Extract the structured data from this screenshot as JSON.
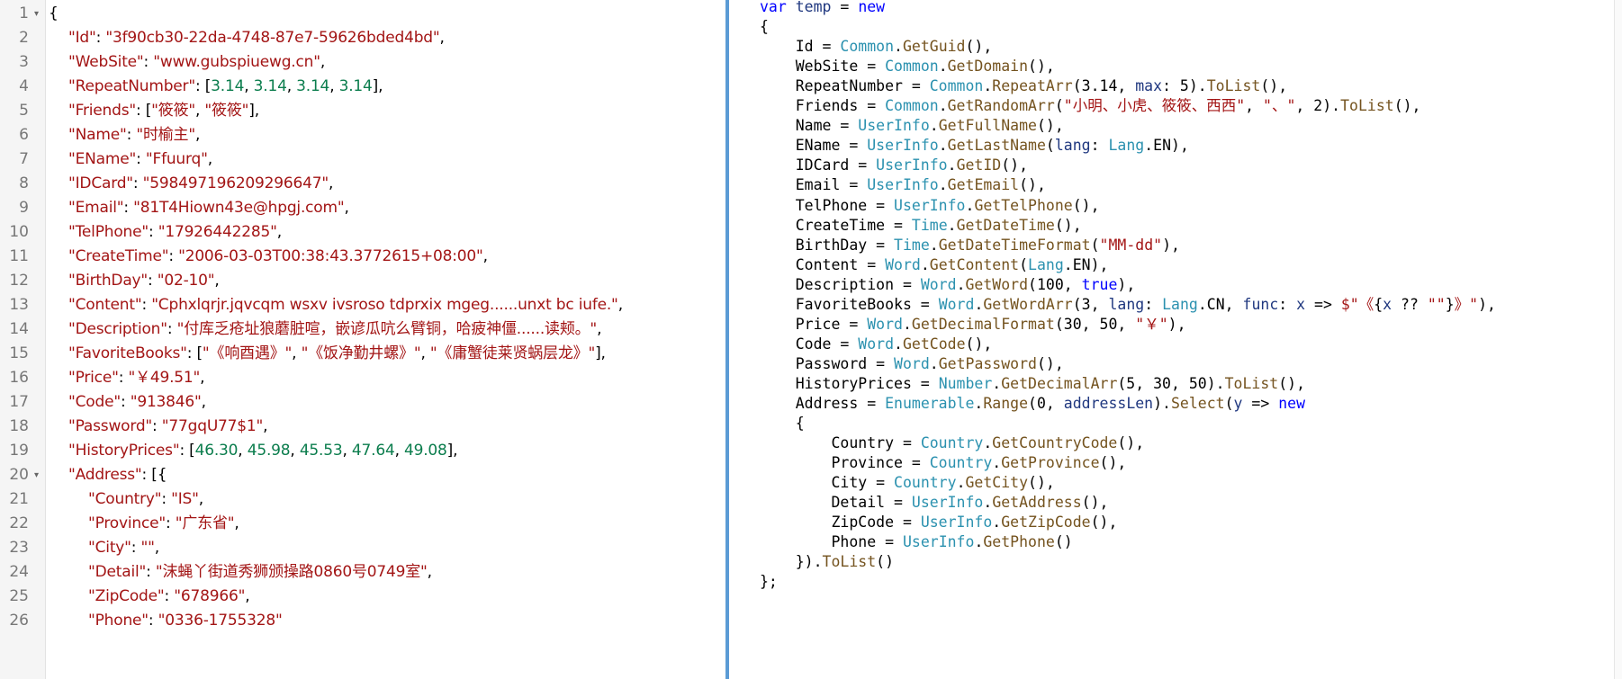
{
  "json_lines": [
    [
      [
        "p",
        "{"
      ]
    ],
    [
      [
        "k",
        "\"Id\""
      ],
      [
        "p",
        ": "
      ],
      [
        "s",
        "\"3f90cb30-22da-4748-87e7-59626bded4bd\""
      ],
      [
        "p",
        ","
      ]
    ],
    [
      [
        "k",
        "\"WebSite\""
      ],
      [
        "p",
        ": "
      ],
      [
        "s",
        "\"www.gubspiuewg.cn\""
      ],
      [
        "p",
        ","
      ]
    ],
    [
      [
        "k",
        "\"RepeatNumber\""
      ],
      [
        "p",
        ": ["
      ],
      [
        "n",
        "3.14"
      ],
      [
        "p",
        ", "
      ],
      [
        "n",
        "3.14"
      ],
      [
        "p",
        ", "
      ],
      [
        "n",
        "3.14"
      ],
      [
        "p",
        ", "
      ],
      [
        "n",
        "3.14"
      ],
      [
        "p",
        "],"
      ]
    ],
    [
      [
        "k",
        "\"Friends\""
      ],
      [
        "p",
        ": ["
      ],
      [
        "s",
        "\"筱筱\""
      ],
      [
        "p",
        ", "
      ],
      [
        "s",
        "\"筱筱\""
      ],
      [
        "p",
        "],"
      ]
    ],
    [
      [
        "k",
        "\"Name\""
      ],
      [
        "p",
        ": "
      ],
      [
        "s",
        "\"时榆主\""
      ],
      [
        "p",
        ","
      ]
    ],
    [
      [
        "k",
        "\"EName\""
      ],
      [
        "p",
        ": "
      ],
      [
        "s",
        "\"Ffuurq\""
      ],
      [
        "p",
        ","
      ]
    ],
    [
      [
        "k",
        "\"IDCard\""
      ],
      [
        "p",
        ": "
      ],
      [
        "s",
        "\"598497196209296647\""
      ],
      [
        "p",
        ","
      ]
    ],
    [
      [
        "k",
        "\"Email\""
      ],
      [
        "p",
        ": "
      ],
      [
        "s",
        "\"81T4Hiown43e@hpgj.com\""
      ],
      [
        "p",
        ","
      ]
    ],
    [
      [
        "k",
        "\"TelPhone\""
      ],
      [
        "p",
        ": "
      ],
      [
        "s",
        "\"17926442285\""
      ],
      [
        "p",
        ","
      ]
    ],
    [
      [
        "k",
        "\"CreateTime\""
      ],
      [
        "p",
        ": "
      ],
      [
        "s",
        "\"2006-03-03T00:38:43.3772615+08:00\""
      ],
      [
        "p",
        ","
      ]
    ],
    [
      [
        "k",
        "\"BirthDay\""
      ],
      [
        "p",
        ": "
      ],
      [
        "s",
        "\"02-10\""
      ],
      [
        "p",
        ","
      ]
    ],
    [
      [
        "k",
        "\"Content\""
      ],
      [
        "p",
        ": "
      ],
      [
        "s",
        "\"Cphxlqrjr.jqvcqm wsxv ivsroso tdprxix mgeg......unxt bc iufe.\""
      ],
      [
        "p",
        ","
      ]
    ],
    [
      [
        "k",
        "\"Description\""
      ],
      [
        "p",
        ": "
      ],
      [
        "s",
        "\"付库乏疮址狼蘑脏喧，嵌谚瓜吭么臂铜，哈疲神僵......读颊。\""
      ],
      [
        "p",
        ","
      ]
    ],
    [
      [
        "k",
        "\"FavoriteBooks\""
      ],
      [
        "p",
        ": ["
      ],
      [
        "s",
        "\"《响酉遇》\""
      ],
      [
        "p",
        ", "
      ],
      [
        "s",
        "\"《饭净勤井螺》\""
      ],
      [
        "p",
        ", "
      ],
      [
        "s",
        "\"《庸蟹徒莱贤蜗层龙》\""
      ],
      [
        "p",
        "],"
      ]
    ],
    [
      [
        "k",
        "\"Price\""
      ],
      [
        "p",
        ": "
      ],
      [
        "s",
        "\"￥49.51\""
      ],
      [
        "p",
        ","
      ]
    ],
    [
      [
        "k",
        "\"Code\""
      ],
      [
        "p",
        ": "
      ],
      [
        "s",
        "\"913846\""
      ],
      [
        "p",
        ","
      ]
    ],
    [
      [
        "k",
        "\"Password\""
      ],
      [
        "p",
        ": "
      ],
      [
        "s",
        "\"77gqU77$1\""
      ],
      [
        "p",
        ","
      ]
    ],
    [
      [
        "k",
        "\"HistoryPrices\""
      ],
      [
        "p",
        ": ["
      ],
      [
        "n",
        "46.30"
      ],
      [
        "p",
        ", "
      ],
      [
        "n",
        "45.98"
      ],
      [
        "p",
        ", "
      ],
      [
        "n",
        "45.53"
      ],
      [
        "p",
        ", "
      ],
      [
        "n",
        "47.64"
      ],
      [
        "p",
        ", "
      ],
      [
        "n",
        "49.08"
      ],
      [
        "p",
        "],"
      ]
    ],
    [
      [
        "k",
        "\"Address\""
      ],
      [
        "p",
        ": [{"
      ]
    ],
    [
      [
        "k",
        "\"Country\""
      ],
      [
        "p",
        ": "
      ],
      [
        "s",
        "\"IS\""
      ],
      [
        "p",
        ","
      ]
    ],
    [
      [
        "k",
        "\"Province\""
      ],
      [
        "p",
        ": "
      ],
      [
        "s",
        "\"广东省\""
      ],
      [
        "p",
        ","
      ]
    ],
    [
      [
        "k",
        "\"City\""
      ],
      [
        "p",
        ": "
      ],
      [
        "s",
        "\"\""
      ],
      [
        "p",
        ","
      ]
    ],
    [
      [
        "k",
        "\"Detail\""
      ],
      [
        "p",
        ": "
      ],
      [
        "s",
        "\"沫蝇丫街道秀狮颁操路0860号0749室\""
      ],
      [
        "p",
        ","
      ]
    ],
    [
      [
        "k",
        "\"ZipCode\""
      ],
      [
        "p",
        ": "
      ],
      [
        "s",
        "\"678966\""
      ],
      [
        "p",
        ","
      ]
    ],
    [
      [
        "k",
        "\"Phone\""
      ],
      [
        "p",
        ": "
      ],
      [
        "s",
        "\"0336-1755328\""
      ]
    ]
  ],
  "code_lines": [
    [
      [
        "kw",
        "var "
      ],
      [
        "pm",
        "temp"
      ],
      [
        "nm",
        " = "
      ],
      [
        "kw",
        "new"
      ]
    ],
    [
      [
        "nm",
        "{"
      ]
    ],
    [
      [
        "nm",
        "    Id = "
      ],
      [
        "ty",
        "Common"
      ],
      [
        "nm",
        "."
      ],
      [
        "mt",
        "GetGuid"
      ],
      [
        "nm",
        "(),"
      ]
    ],
    [
      [
        "nm",
        "    WebSite = "
      ],
      [
        "ty",
        "Common"
      ],
      [
        "nm",
        "."
      ],
      [
        "mt",
        "GetDomain"
      ],
      [
        "nm",
        "(),"
      ]
    ],
    [
      [
        "nm",
        "    RepeatNumber = "
      ],
      [
        "ty",
        "Common"
      ],
      [
        "nm",
        "."
      ],
      [
        "mt",
        "RepeatArr"
      ],
      [
        "nm",
        "(3.14, "
      ],
      [
        "pm",
        "max"
      ],
      [
        "nm",
        ": 5)."
      ],
      [
        "mt",
        "ToList"
      ],
      [
        "nm",
        "(),"
      ]
    ],
    [
      [
        "nm",
        "    Friends = "
      ],
      [
        "ty",
        "Common"
      ],
      [
        "nm",
        "."
      ],
      [
        "mt",
        "GetRandomArr"
      ],
      [
        "nm",
        "("
      ],
      [
        "st",
        "\"小明、小虎、筱筱、西西\""
      ],
      [
        "nm",
        ", "
      ],
      [
        "st",
        "\"、\""
      ],
      [
        "nm",
        ", 2)."
      ],
      [
        "mt",
        "ToList"
      ],
      [
        "nm",
        "(),"
      ]
    ],
    [
      [
        "nm",
        "    Name = "
      ],
      [
        "ty",
        "UserInfo"
      ],
      [
        "nm",
        "."
      ],
      [
        "mt",
        "GetFullName"
      ],
      [
        "nm",
        "(),"
      ]
    ],
    [
      [
        "nm",
        "    EName = "
      ],
      [
        "ty",
        "UserInfo"
      ],
      [
        "nm",
        "."
      ],
      [
        "mt",
        "GetLastName"
      ],
      [
        "nm",
        "("
      ],
      [
        "pm",
        "lang"
      ],
      [
        "nm",
        ": "
      ],
      [
        "ty",
        "Lang"
      ],
      [
        "nm",
        ".EN),"
      ]
    ],
    [
      [
        "nm",
        "    IDCard = "
      ],
      [
        "ty",
        "UserInfo"
      ],
      [
        "nm",
        "."
      ],
      [
        "mt",
        "GetID"
      ],
      [
        "nm",
        "(),"
      ]
    ],
    [
      [
        "nm",
        "    Email = "
      ],
      [
        "ty",
        "UserInfo"
      ],
      [
        "nm",
        "."
      ],
      [
        "mt",
        "GetEmail"
      ],
      [
        "nm",
        "(),"
      ]
    ],
    [
      [
        "nm",
        "    TelPhone = "
      ],
      [
        "ty",
        "UserInfo"
      ],
      [
        "nm",
        "."
      ],
      [
        "mt",
        "GetTelPhone"
      ],
      [
        "nm",
        "(),"
      ]
    ],
    [
      [
        "nm",
        "    CreateTime = "
      ],
      [
        "ty",
        "Time"
      ],
      [
        "nm",
        "."
      ],
      [
        "mt",
        "GetDateTime"
      ],
      [
        "nm",
        "(),"
      ]
    ],
    [
      [
        "nm",
        "    BirthDay = "
      ],
      [
        "ty",
        "Time"
      ],
      [
        "nm",
        "."
      ],
      [
        "mt",
        "GetDateTimeFormat"
      ],
      [
        "nm",
        "("
      ],
      [
        "st",
        "\"MM-dd\""
      ],
      [
        "nm",
        "),"
      ]
    ],
    [
      [
        "nm",
        "    Content = "
      ],
      [
        "ty",
        "Word"
      ],
      [
        "nm",
        "."
      ],
      [
        "mt",
        "GetContent"
      ],
      [
        "nm",
        "("
      ],
      [
        "ty",
        "Lang"
      ],
      [
        "nm",
        ".EN),"
      ]
    ],
    [
      [
        "nm",
        "    Description = "
      ],
      [
        "ty",
        "Word"
      ],
      [
        "nm",
        "."
      ],
      [
        "mt",
        "GetWord"
      ],
      [
        "nm",
        "(100, "
      ],
      [
        "kw",
        "true"
      ],
      [
        "nm",
        "),"
      ]
    ],
    [
      [
        "nm",
        "    FavoriteBooks = "
      ],
      [
        "ty",
        "Word"
      ],
      [
        "nm",
        "."
      ],
      [
        "mt",
        "GetWordArr"
      ],
      [
        "nm",
        "(3, "
      ],
      [
        "pm",
        "lang"
      ],
      [
        "nm",
        ": "
      ],
      [
        "ty",
        "Lang"
      ],
      [
        "nm",
        ".CN, "
      ],
      [
        "pm",
        "func"
      ],
      [
        "nm",
        ": "
      ],
      [
        "pm",
        "x"
      ],
      [
        "nm",
        " => "
      ],
      [
        "st",
        "$\"《"
      ],
      [
        "nm",
        "{"
      ],
      [
        "pm",
        "x"
      ],
      [
        "nm",
        " ?? "
      ],
      [
        "st",
        "\"\""
      ],
      [
        "nm",
        "}"
      ],
      [
        "st",
        "》\""
      ],
      [
        "nm",
        "),"
      ]
    ],
    [
      [
        "nm",
        "    Price = "
      ],
      [
        "ty",
        "Word"
      ],
      [
        "nm",
        "."
      ],
      [
        "mt",
        "GetDecimalFormat"
      ],
      [
        "nm",
        "(30, 50, "
      ],
      [
        "st",
        "\"￥\""
      ],
      [
        "nm",
        "),"
      ]
    ],
    [
      [
        "nm",
        "    Code = "
      ],
      [
        "ty",
        "Word"
      ],
      [
        "nm",
        "."
      ],
      [
        "mt",
        "GetCode"
      ],
      [
        "nm",
        "(),"
      ]
    ],
    [
      [
        "nm",
        "    Password = "
      ],
      [
        "ty",
        "Word"
      ],
      [
        "nm",
        "."
      ],
      [
        "mt",
        "GetPassword"
      ],
      [
        "nm",
        "(),"
      ]
    ],
    [
      [
        "nm",
        "    HistoryPrices = "
      ],
      [
        "ty",
        "Number"
      ],
      [
        "nm",
        "."
      ],
      [
        "mt",
        "GetDecimalArr"
      ],
      [
        "nm",
        "(5, 30, 50)."
      ],
      [
        "mt",
        "ToList"
      ],
      [
        "nm",
        "(),"
      ]
    ],
    [
      [
        "nm",
        "    Address = "
      ],
      [
        "ty",
        "Enumerable"
      ],
      [
        "nm",
        "."
      ],
      [
        "mt",
        "Range"
      ],
      [
        "nm",
        "(0, "
      ],
      [
        "pm",
        "addressLen"
      ],
      [
        "nm",
        ")."
      ],
      [
        "mt",
        "Select"
      ],
      [
        "nm",
        "("
      ],
      [
        "pm",
        "y"
      ],
      [
        "nm",
        " => "
      ],
      [
        "kw",
        "new"
      ]
    ],
    [
      [
        "nm",
        "    {"
      ]
    ],
    [
      [
        "nm",
        "        Country = "
      ],
      [
        "ty",
        "Country"
      ],
      [
        "nm",
        "."
      ],
      [
        "mt",
        "GetCountryCode"
      ],
      [
        "nm",
        "(),"
      ]
    ],
    [
      [
        "nm",
        "        Province = "
      ],
      [
        "ty",
        "Country"
      ],
      [
        "nm",
        "."
      ],
      [
        "mt",
        "GetProvince"
      ],
      [
        "nm",
        "(),"
      ]
    ],
    [
      [
        "nm",
        "        City = "
      ],
      [
        "ty",
        "Country"
      ],
      [
        "nm",
        "."
      ],
      [
        "mt",
        "GetCity"
      ],
      [
        "nm",
        "(),"
      ]
    ],
    [
      [
        "nm",
        "        Detail = "
      ],
      [
        "ty",
        "UserInfo"
      ],
      [
        "nm",
        "."
      ],
      [
        "mt",
        "GetAddress"
      ],
      [
        "nm",
        "(),"
      ]
    ],
    [
      [
        "nm",
        "        ZipCode = "
      ],
      [
        "ty",
        "UserInfo"
      ],
      [
        "nm",
        "."
      ],
      [
        "mt",
        "GetZipCode"
      ],
      [
        "nm",
        "(),"
      ]
    ],
    [
      [
        "nm",
        "        Phone = "
      ],
      [
        "ty",
        "UserInfo"
      ],
      [
        "nm",
        "."
      ],
      [
        "mt",
        "GetPhone"
      ],
      [
        "nm",
        "()"
      ]
    ],
    [
      [
        "nm",
        "    })."
      ],
      [
        "mt",
        "ToList"
      ],
      [
        "nm",
        "()"
      ]
    ],
    [
      [
        "nm",
        "};"
      ]
    ]
  ],
  "line_numbers": [
    "1",
    "2",
    "3",
    "4",
    "5",
    "6",
    "7",
    "8",
    "9",
    "10",
    "11",
    "12",
    "13",
    "14",
    "15",
    "16",
    "17",
    "18",
    "19",
    "20",
    "21",
    "22",
    "23",
    "24",
    "25",
    "26"
  ],
  "fold_markers": [
    "▾",
    "▾"
  ]
}
